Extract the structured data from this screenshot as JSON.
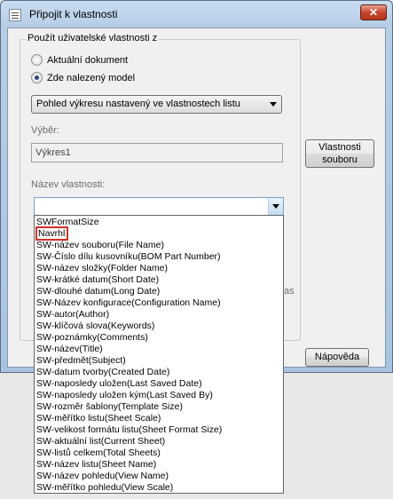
{
  "window": {
    "title": "Připojit k vlastnosti",
    "close_label": "✕"
  },
  "source_group": {
    "label": "Použít uživatelské vlastnosti z",
    "options": [
      {
        "label": "Aktuální dokument",
        "checked": false
      },
      {
        "label": "Zde nalezený model",
        "checked": true
      }
    ],
    "view_select": {
      "value": "Pohled výkresu nastavený ve vlastnostech listu"
    }
  },
  "selection": {
    "label": "Výběr:",
    "value": "Výkres1"
  },
  "file_properties_button": {
    "line1": "Vlastnosti",
    "line2": "souboru"
  },
  "property_name": {
    "label": "Název vlastnosti:",
    "value": ""
  },
  "hidden_fragment": "as",
  "help_button": {
    "label": "Nápověda"
  },
  "property_list": {
    "items": [
      "SWFormatSize",
      "Navrhl",
      "SW-název souboru(File Name)",
      "SW-Číslo dílu kusovníku(BOM Part Number)",
      "SW-název složky(Folder Name)",
      "SW-krátké datum(Short Date)",
      "SW-dlouhé datum(Long Date)",
      "SW-Název konfigurace(Configuration Name)",
      "SW-autor(Author)",
      "SW-klíčová slova(Keywords)",
      "SW-poznámky(Comments)",
      "SW-název(Title)",
      "SW-předmět(Subject)",
      "SW-datum tvorby(Created Date)",
      "SW-naposledy uložen(Last Saved Date)",
      "SW-naposledy uložen kým(Last Saved By)",
      "SW-rozměr šablony(Template Size)",
      "SW-měřítko listu(Sheet Scale)",
      "SW-velikost formátu listu(Sheet Format Size)",
      "SW-aktuální list(Current Sheet)",
      "SW-listů celkem(Total Sheets)",
      "SW-název listu(Sheet Name)",
      "SW-název pohledu(View Name)",
      "SW-měřítko pohledu(View Scale)"
    ],
    "highlighted_index": 1,
    "highlight_color": "#d0302a"
  }
}
